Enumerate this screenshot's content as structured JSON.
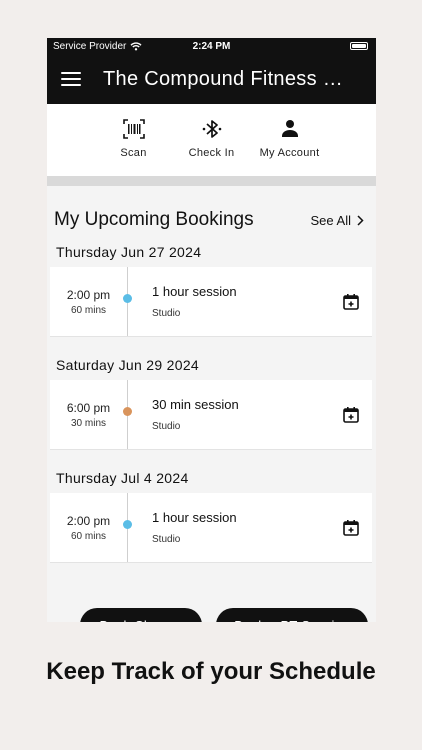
{
  "status_bar": {
    "carrier": "Service Provider",
    "time": "2:24 PM"
  },
  "header": {
    "title": "The Compound Fitness Cl..."
  },
  "quick_actions": [
    {
      "label": "Scan",
      "icon": "barcode-icon"
    },
    {
      "label": "Check In",
      "icon": "bluetooth-icon"
    },
    {
      "label": "My Account",
      "icon": "person-icon"
    }
  ],
  "bookings": {
    "title": "My Upcoming Bookings",
    "see_all": "See All",
    "items": [
      {
        "date": "Thursday Jun 27 2024",
        "time": "2:00 pm",
        "duration": "60 mins",
        "name": "1 hour session",
        "location": "Studio",
        "dot_color": "#5bbde6"
      },
      {
        "date": "Saturday Jun 29 2024",
        "time": "6:00 pm",
        "duration": "30 mins",
        "name": "30 min session",
        "location": "Studio",
        "dot_color": "#d9945c"
      },
      {
        "date": "Thursday Jul 4 2024",
        "time": "2:00 pm",
        "duration": "60 mins",
        "name": "1 hour session",
        "location": "Studio",
        "dot_color": "#5bbde6"
      }
    ]
  },
  "buttons": {
    "book_classes": "Book Classes",
    "book_pt": "Book a PT Session"
  },
  "caption": "Keep Track of your Schedule"
}
